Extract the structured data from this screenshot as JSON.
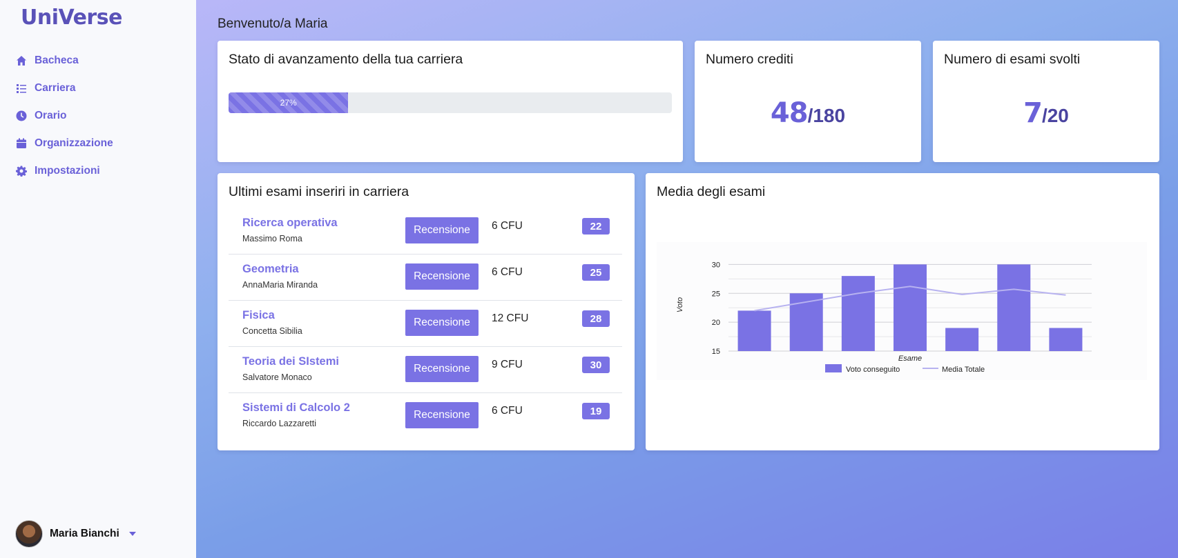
{
  "app": {
    "logo": "UniVerse"
  },
  "sidebar": {
    "items": [
      {
        "label": "Bacheca",
        "icon": "home-icon"
      },
      {
        "label": "Carriera",
        "icon": "list-icon"
      },
      {
        "label": "Orario",
        "icon": "clock-icon"
      },
      {
        "label": "Organizzazione",
        "icon": "calendar-icon"
      },
      {
        "label": "Impostazioni",
        "icon": "gear-icon"
      }
    ],
    "user": {
      "name": "Maria Bianchi"
    }
  },
  "header": {
    "welcome": "Benvenuto/a Maria"
  },
  "progress_card": {
    "title": "Stato di avanzamento della tua carriera",
    "percent": 27,
    "label": "27%"
  },
  "credits_card": {
    "title": "Numero crediti",
    "value": "48",
    "total": "/180"
  },
  "exams_card": {
    "title": "Numero di esami svolti",
    "value": "7",
    "total": "/20"
  },
  "recent_exams": {
    "title": "Ultimi esami inseriri in carriera",
    "button_label": "Recensione",
    "rows": [
      {
        "name": "Ricerca operativa",
        "prof": "Massimo Roma",
        "cfu": "6 CFU",
        "grade": "22"
      },
      {
        "name": "Geometria",
        "prof": "AnnaMaria Miranda",
        "cfu": "6 CFU",
        "grade": "25"
      },
      {
        "name": "Fisica",
        "prof": "Concetta Sibilia",
        "cfu": "12 CFU",
        "grade": "28"
      },
      {
        "name": "Teoria dei SIstemi",
        "prof": "Salvatore Monaco",
        "cfu": "9 CFU",
        "grade": "30"
      },
      {
        "name": "Sistemi di Calcolo 2",
        "prof": "Riccardo Lazzaretti",
        "cfu": "6 CFU",
        "grade": "19"
      }
    ]
  },
  "chart_card": {
    "title": "Media degli esami"
  },
  "colors": {
    "accent": "#7a72e4",
    "line": "#b7b2f0",
    "dark_accent": "#5a52b8"
  },
  "chart_data": {
    "type": "bar",
    "title": "",
    "xlabel": "Esame",
    "ylabel": "Voto",
    "ylim": [
      15,
      31
    ],
    "yticks": [
      15,
      20,
      25,
      30
    ],
    "grid": true,
    "legend": "bottom",
    "series": [
      {
        "name": "Voto conseguito",
        "type": "bar",
        "values": [
          22,
          25,
          28,
          30,
          19,
          30,
          19
        ]
      },
      {
        "name": "Media Totale",
        "type": "line",
        "values": [
          22,
          23.5,
          25,
          26.2,
          24.8,
          25.7,
          24.7
        ]
      }
    ]
  }
}
